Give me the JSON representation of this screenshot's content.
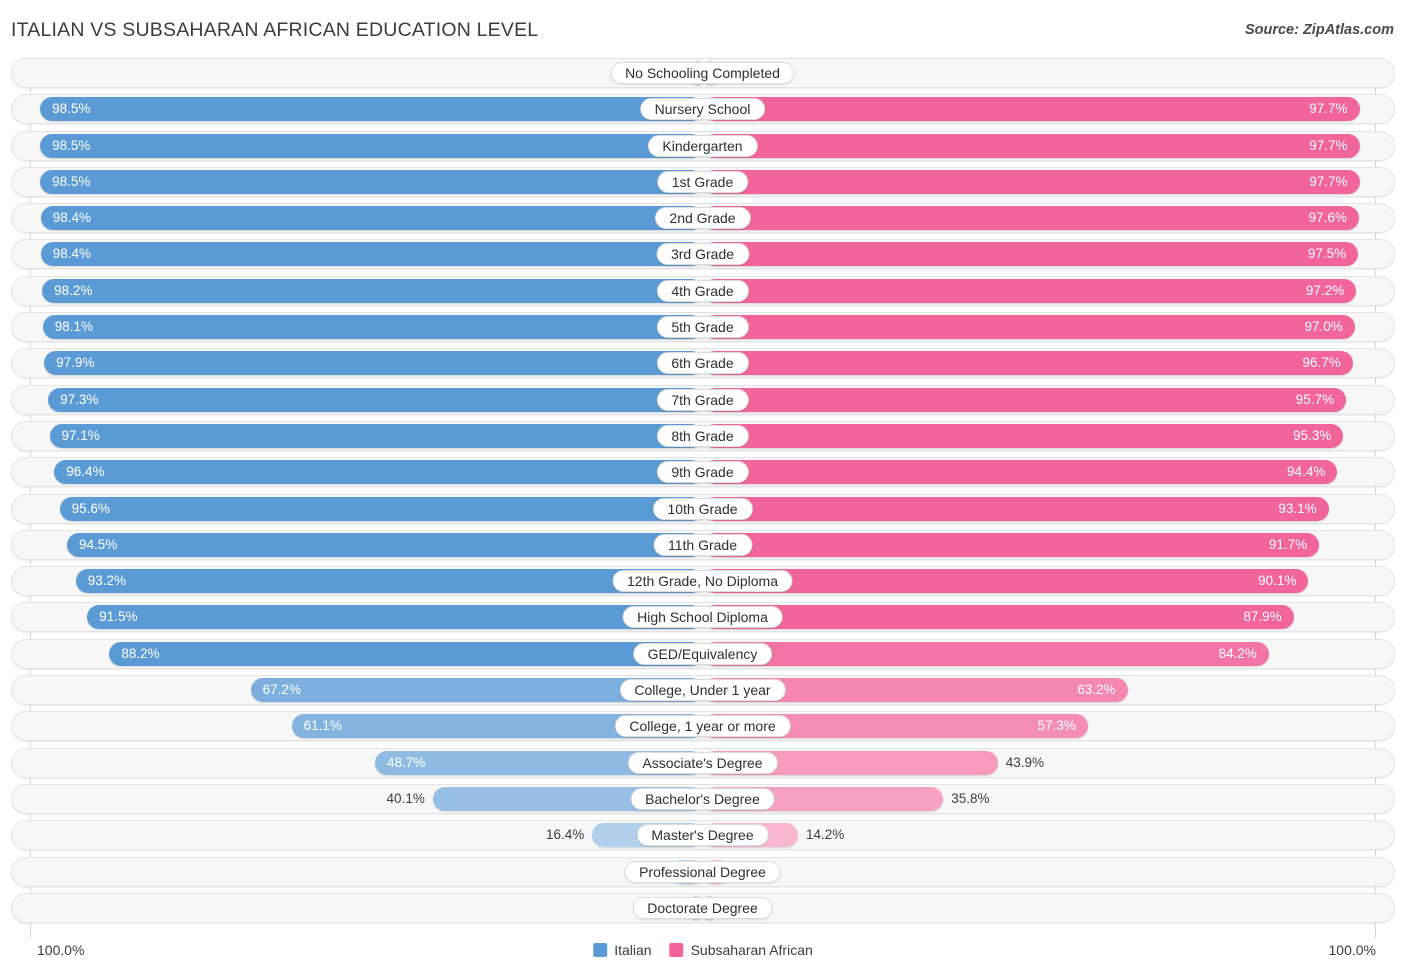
{
  "header": {
    "title": "ITALIAN VS SUBSAHARAN AFRICAN EDUCATION LEVEL",
    "source": "Source: ZipAtlas.com"
  },
  "footer": {
    "axis_min": "100.0%",
    "axis_max": "100.0%",
    "legend": [
      {
        "label": "Italian",
        "color": "#5b9bd5"
      },
      {
        "label": "Subsaharan African",
        "color": "#f2659a"
      }
    ]
  },
  "colors": {
    "italian": "#5b9bd5",
    "subsaharan_african": "#f2659a",
    "track": "#f7f7f7",
    "track_border": "#e4e4e4",
    "gridline": "#d6d6d6"
  },
  "chart_data": {
    "type": "bar",
    "subtype": "diverging-bidirectional",
    "title": "ITALIAN VS SUBSAHARAN AFRICAN EDUCATION LEVEL",
    "xlabel": "",
    "ylabel": "",
    "xlim": [
      0,
      100
    ],
    "grid": false,
    "legend_position": "bottom-center",
    "axis_min_label": "100.0%",
    "axis_max_label": "100.0%",
    "categories": [
      "No Schooling Completed",
      "Nursery School",
      "Kindergarten",
      "1st Grade",
      "2nd Grade",
      "3rd Grade",
      "4th Grade",
      "5th Grade",
      "6th Grade",
      "7th Grade",
      "8th Grade",
      "9th Grade",
      "10th Grade",
      "11th Grade",
      "12th Grade, No Diploma",
      "High School Diploma",
      "GED/Equivalency",
      "College, Under 1 year",
      "College, 1 year or more",
      "Associate's Degree",
      "Bachelor's Degree",
      "Master's Degree",
      "Professional Degree",
      "Doctorate Degree"
    ],
    "series": [
      {
        "name": "Italian",
        "color": "#5b9bd5",
        "side": "left",
        "values": [
          1.5,
          98.5,
          98.5,
          98.5,
          98.4,
          98.4,
          98.2,
          98.1,
          97.9,
          97.3,
          97.1,
          96.4,
          95.6,
          94.5,
          93.2,
          91.5,
          88.2,
          67.2,
          61.1,
          48.7,
          40.1,
          16.4,
          4.8,
          2.0
        ],
        "labels": [
          "1.5%",
          "98.5%",
          "98.5%",
          "98.5%",
          "98.4%",
          "98.4%",
          "98.2%",
          "98.1%",
          "97.9%",
          "97.3%",
          "97.1%",
          "96.4%",
          "95.6%",
          "94.5%",
          "93.2%",
          "91.5%",
          "88.2%",
          "67.2%",
          "61.1%",
          "48.7%",
          "40.1%",
          "16.4%",
          "4.8%",
          "2.0%"
        ]
      },
      {
        "name": "Subsaharan African",
        "color": "#f2659a",
        "side": "right",
        "values": [
          2.3,
          97.7,
          97.7,
          97.7,
          97.6,
          97.5,
          97.2,
          97.0,
          96.7,
          95.7,
          95.3,
          94.4,
          93.1,
          91.7,
          90.1,
          87.9,
          84.2,
          63.2,
          57.3,
          43.9,
          35.8,
          14.2,
          4.1,
          1.8
        ],
        "labels": [
          "2.3%",
          "97.7%",
          "97.7%",
          "97.7%",
          "97.6%",
          "97.5%",
          "97.2%",
          "97.0%",
          "96.7%",
          "95.7%",
          "95.3%",
          "94.4%",
          "93.1%",
          "91.7%",
          "90.1%",
          "87.9%",
          "84.2%",
          "63.2%",
          "57.3%",
          "43.9%",
          "35.8%",
          "14.2%",
          "4.1%",
          "1.8%"
        ]
      }
    ]
  }
}
